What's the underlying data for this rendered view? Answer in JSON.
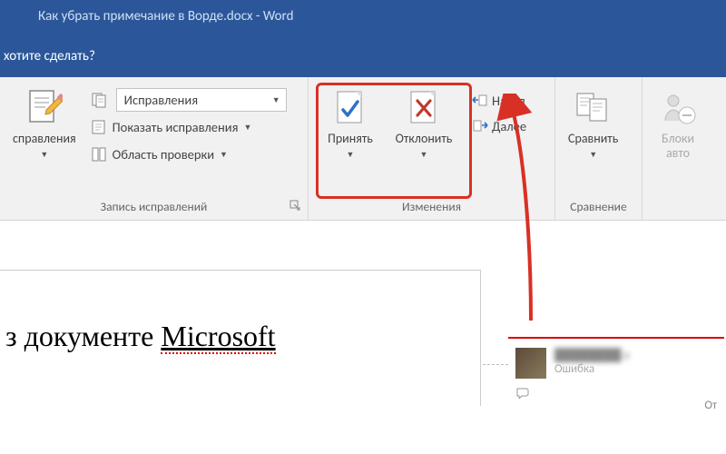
{
  "titlebar": {
    "text": "Как убрать примечание в Ворде.docx - Word"
  },
  "tellme": {
    "text": "хотите сделать?"
  },
  "ribbon": {
    "tracking_group": {
      "label": "Запись исправлений",
      "track_changes_btn": "справления",
      "display_combo": "Исправления",
      "show_markup": "Показать исправления",
      "reviewing_pane": "Область проверки"
    },
    "changes_group": {
      "label": "Изменения",
      "accept": "Принять",
      "reject": "Отклонить",
      "previous": "Назад",
      "next": "Далее"
    },
    "compare_group": {
      "label": "Сравнение",
      "compare": "Сравнить"
    },
    "protect_group": {
      "block_authors_line1": "Блоки",
      "block_authors_line2": "авто"
    }
  },
  "document": {
    "visible_text_prefix": "з документе ",
    "visible_text_underlined": "Microsoft"
  },
  "comment": {
    "author": "████████ в",
    "body": "Ошибка",
    "reply_label": "От"
  }
}
